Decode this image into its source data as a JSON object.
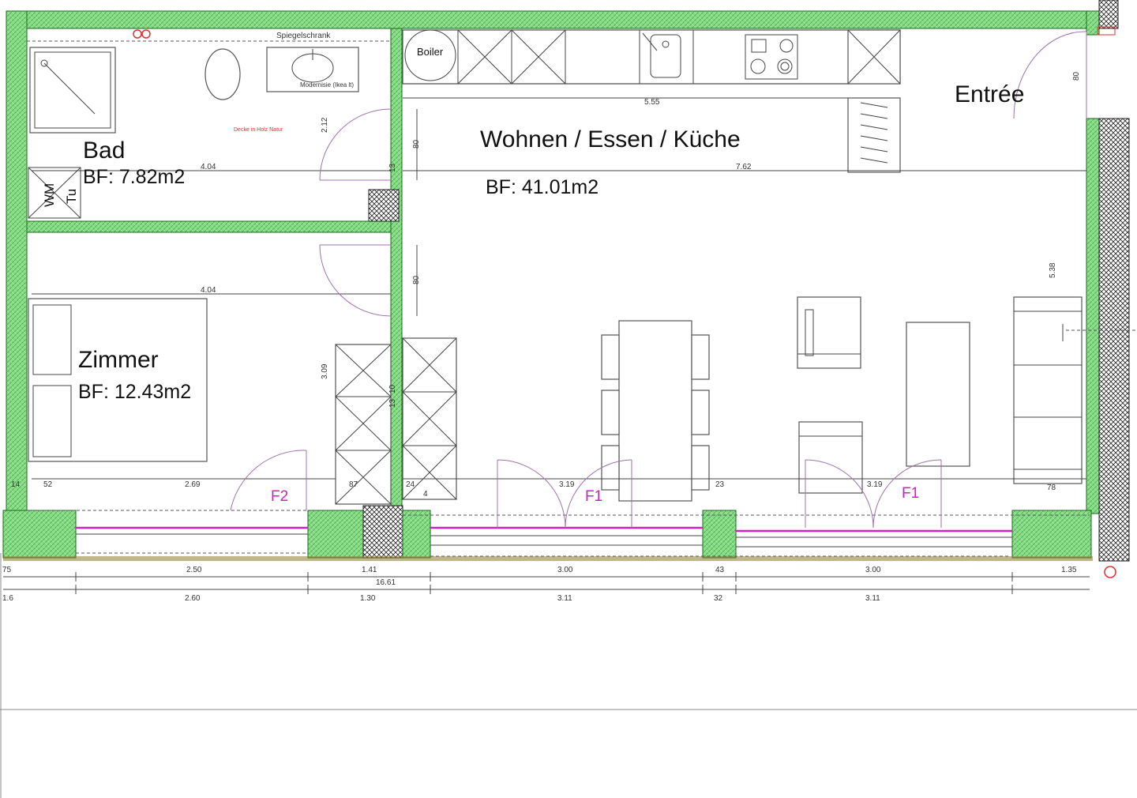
{
  "rooms": {
    "bad": {
      "name": "Bad",
      "area": "BF: 7.82m2"
    },
    "wohnen": {
      "name": "Wohnen / Essen / Küche",
      "area": "BF: 41.01m2"
    },
    "zimmer": {
      "name": "Zimmer",
      "area": "BF: 12.43m2"
    },
    "entree": {
      "name": "Entrée"
    }
  },
  "labels": {
    "boiler": "Boiler",
    "spiegelschrank": "Spiegelschrank",
    "wm": "WM",
    "tu": "Tu",
    "decke": "Decke in Holz Natur",
    "modernisation": "Modernisie (Ikea lt)"
  },
  "windows": {
    "f2": "F2",
    "f1_left": "F1",
    "f1_right": "F1"
  },
  "dimensions": {
    "bad_width": "4.04",
    "zimmer_width": "4.04",
    "kitchen_top": "5.55",
    "living_width": "7.62",
    "living_depth": "5.38",
    "bad_depth": "2.12",
    "zimmer_depth": "3.09",
    "door1": "80",
    "door2": "80",
    "entree_door": "80",
    "d_52": "52",
    "d_269": "2.69",
    "d_87": "87",
    "d_24": "24",
    "d_319a": "3.19",
    "d_23": "23",
    "d_319b": "3.19",
    "d_78": "78",
    "d_14": "14",
    "d_13a": "13",
    "d_13b": "13",
    "d_10": "10",
    "d_4": "4",
    "bottom": {
      "b_75": "75",
      "b_250": "2.50",
      "b_141": "1.41",
      "b_300a": "3.00",
      "b_43": "43",
      "b_300b": "3.00",
      "b_135": "1.35",
      "total": "16.61"
    },
    "bottom2": {
      "c_16": "1.6",
      "c_260": "2.60",
      "c_130": "1.30",
      "c_311a": "3.11",
      "c_32": "32",
      "c_311b": "3.11"
    }
  },
  "colors": {
    "wall_green": "#7ed67e",
    "wall_dark": "#1a6a1a",
    "window": "#d020c0",
    "door_arc": "#a070b0",
    "section_mark": "#e03030"
  }
}
